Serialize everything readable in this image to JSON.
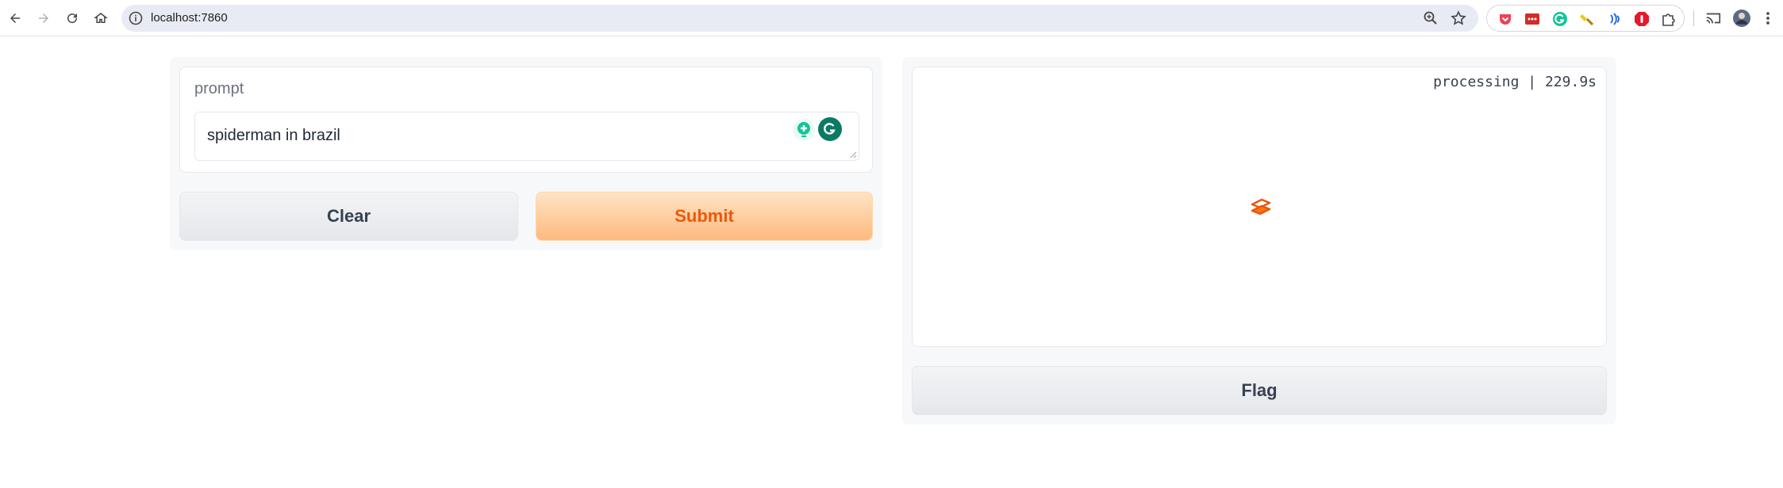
{
  "browser": {
    "url": "localhost:7860",
    "icons": [
      "back-icon",
      "forward-icon",
      "reload-icon",
      "home-icon",
      "site-info-icon",
      "zoom-icon",
      "bookmark-star-icon"
    ],
    "extensions": [
      "pocket-icon",
      "lastpass-icon",
      "grammarly-icon",
      "highlighter-icon",
      "read-aloud-icon",
      "adblock-icon",
      "extensions-puzzle-icon"
    ],
    "colors": {
      "omnibox": "#e9ebf4",
      "accent": "#ea580c"
    }
  },
  "app": {
    "prompt_label": "prompt",
    "prompt_value": "spiderman in brazil",
    "clear_label": "Clear",
    "submit_label": "Submit",
    "status": "processing | 229.9s",
    "flag_label": "Flag"
  }
}
